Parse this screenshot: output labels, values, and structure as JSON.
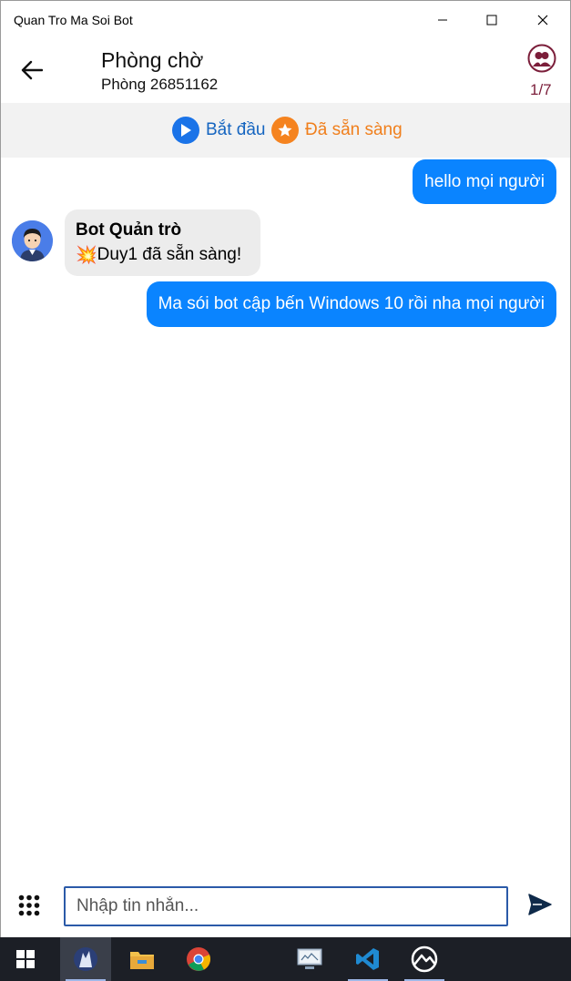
{
  "window": {
    "title": "Quan Tro Ma Soi Bot"
  },
  "header": {
    "title": "Phòng chờ",
    "subtitle": "Phòng 26851162",
    "player_count": "1/7"
  },
  "actions": {
    "start_label": "Bắt đầu",
    "ready_label": "Đã sẵn sàng"
  },
  "messages": {
    "outgoing_1": "hello mọi người",
    "incoming_1": {
      "sender": "Bot Quản trò",
      "emoji": "💥",
      "text": "Duy1 đã sẵn sàng!"
    },
    "outgoing_2": "Ma sói bot cập bến Windows 10 rồi nha mọi người"
  },
  "composer": {
    "placeholder": "Nhập tin nhắn..."
  },
  "colors": {
    "accent": "#0a84ff",
    "ready": "#f5831f",
    "people": "#7b1e3a"
  },
  "taskbar": {
    "items": [
      "windows-start",
      "werewolf-app",
      "file-explorer",
      "chrome",
      "remote-desktop",
      "vscode",
      "app"
    ]
  }
}
